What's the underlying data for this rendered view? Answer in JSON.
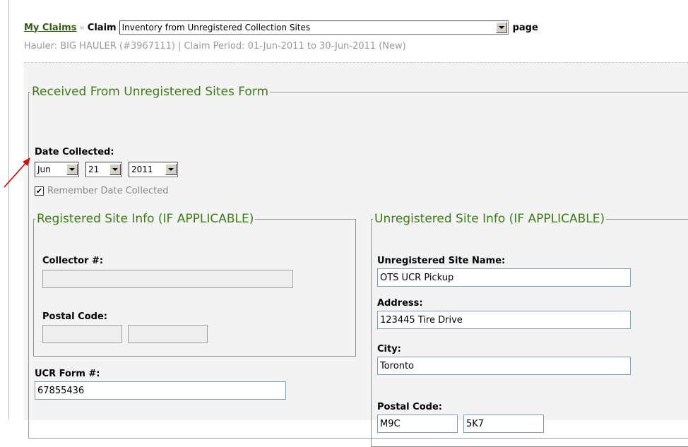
{
  "breadcrumb": {
    "link": "My Claims",
    "separator": "»",
    "claim_label": "Claim",
    "claim_select_value": "Inventory from Unregistered Collection Sites",
    "page_label": "page"
  },
  "info_line": "Hauler: BIG HAULER (#3967111) | Claim Period: 01-Jun-2011 to 30-Jun-2011 (New)",
  "form": {
    "legend": "Received From Unregistered Sites Form",
    "date_label": "Date Collected:",
    "month": "Jun",
    "day": "21",
    "year": "2011",
    "remember_checked": true,
    "remember_label": "Remember Date Collected",
    "ucr_label": "UCR Form #:",
    "ucr_value": "67855436"
  },
  "registered": {
    "legend": "Registered Site Info (IF APPLICABLE)",
    "collector_label": "Collector #:",
    "collector_value": "",
    "postal_label": "Postal Code:",
    "postal1": "",
    "postal2": ""
  },
  "unregistered": {
    "legend": "Unregistered Site Info (IF APPLICABLE)",
    "name_label": "Unregistered Site Name:",
    "name_value": "OTS UCR Pickup",
    "address_label": "Address:",
    "address_value": "123445 Tire Drive",
    "city_label": "City:",
    "city_value": "Toronto",
    "postal_label": "Postal Code:",
    "postal1": "M9C",
    "postal2": "5K7"
  },
  "colors": {
    "link_green": "#2e5c0e",
    "legend_green": "#3d7d17",
    "panel_bg": "#f3f3f3",
    "annotation_arrow": "#e00000"
  },
  "icons": {
    "dropdown": "chevron-down-icon",
    "check": "check-icon",
    "annotation": "red-arrow-annotation"
  }
}
